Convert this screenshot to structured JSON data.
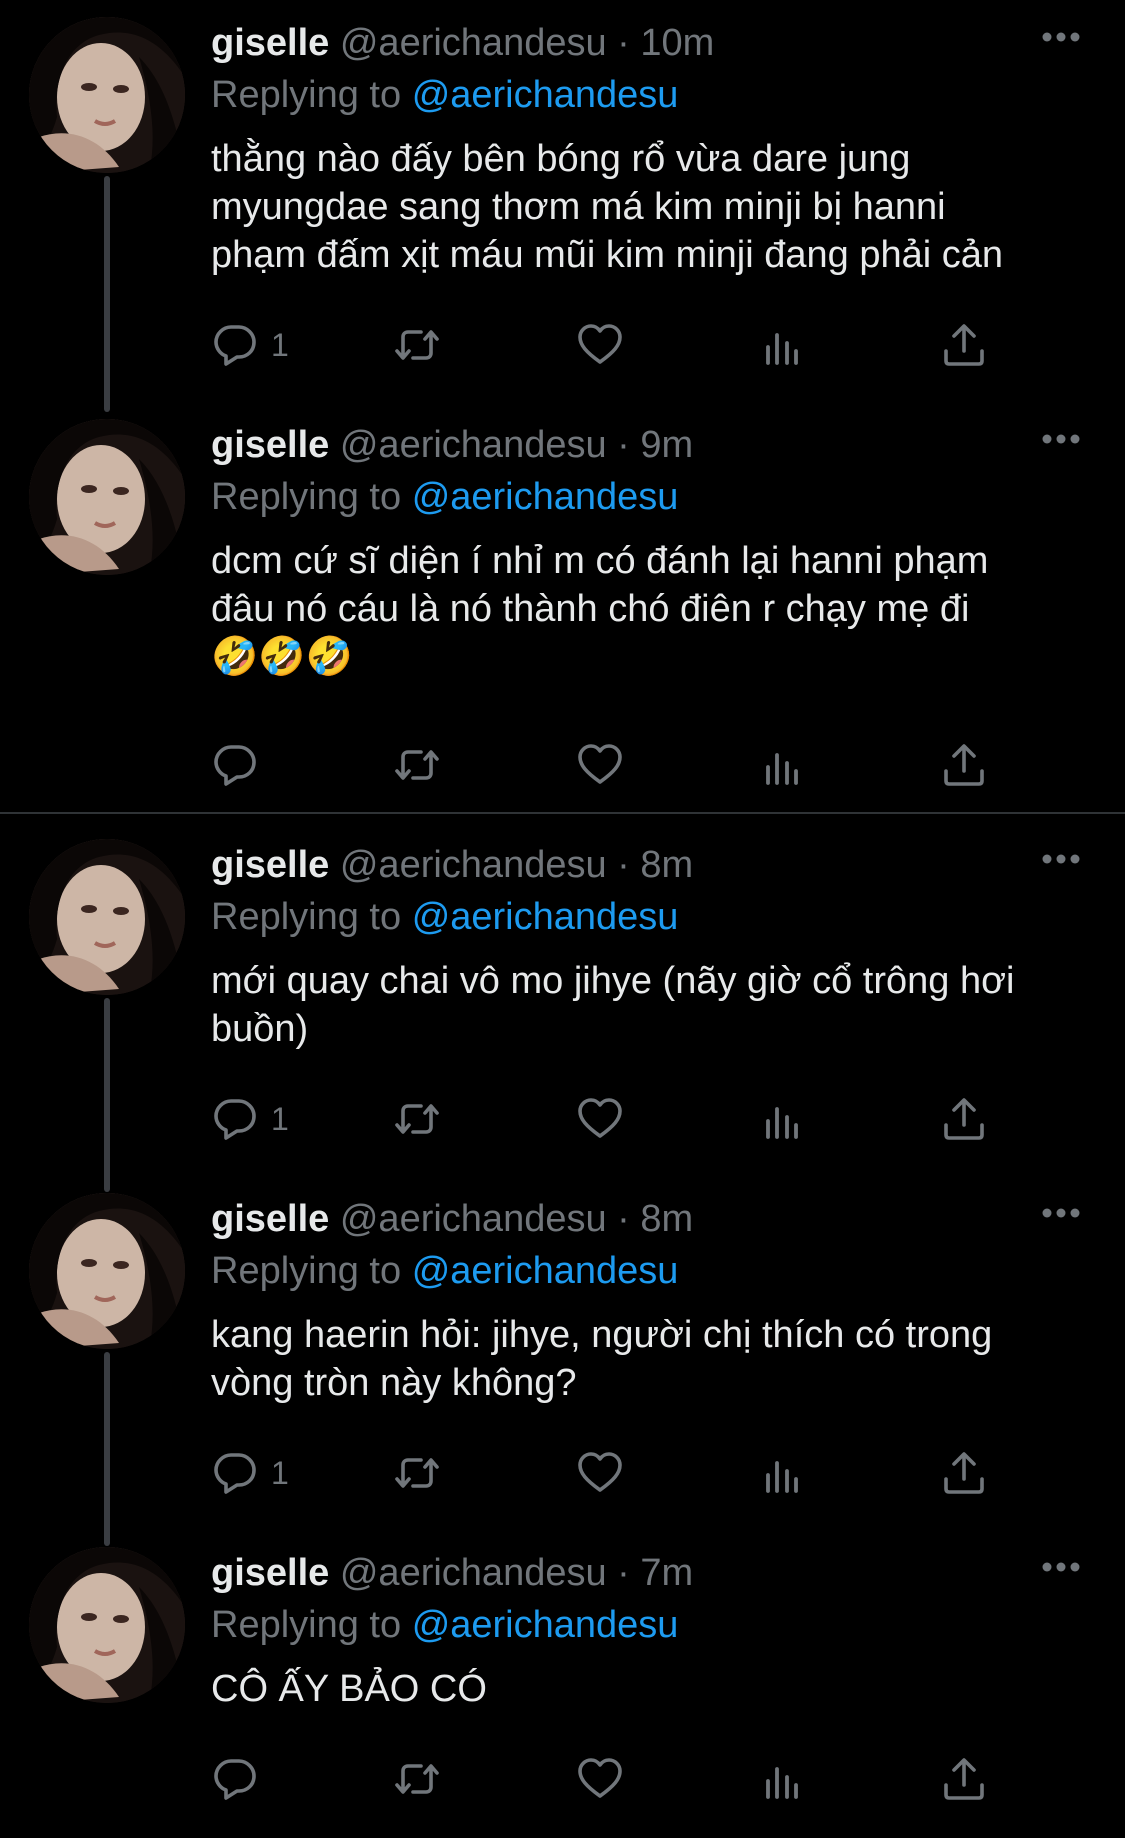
{
  "colors": {
    "background": "#000000",
    "text": "#e7e9ea",
    "muted": "#71767b",
    "accent": "#1d9bf0",
    "thread_line": "#3a3d42",
    "divider": "#2f3336"
  },
  "icons": {
    "more": "more-horizontal-icon",
    "reply": "reply-bubble-icon",
    "retweet": "retweet-icon",
    "like": "heart-icon",
    "views": "analytics-bars-icon",
    "share": "share-upload-icon"
  },
  "tweets": [
    {
      "name": "giselle",
      "handle": "@aerichandesu",
      "separator": "·",
      "time": "10m",
      "replying_label": "Replying to",
      "replying_to": "@aerichandesu",
      "text": "thằng nào đấy bên bóng rổ vừa dare jung\nmyungdae sang thơm má kim minji bị hanni\nphạm đấm xịt máu mũi kim minji đang phải cản",
      "reply_count": "1"
    },
    {
      "name": "giselle",
      "handle": "@aerichandesu",
      "separator": "·",
      "time": "9m",
      "replying_label": "Replying to",
      "replying_to": "@aerichandesu",
      "text": "dcm cứ sĩ diện í nhỉ m có đánh lại hanni phạm\nđâu nó cáu là nó thành chó điên r chạy mẹ đi\n🤣🤣🤣",
      "reply_count": ""
    },
    {
      "name": "giselle",
      "handle": "@aerichandesu",
      "separator": "·",
      "time": "8m",
      "replying_label": "Replying to",
      "replying_to": "@aerichandesu",
      "text": "mới quay chai vô mo jihye (nãy giờ cổ trông hơi\nbuồn)",
      "reply_count": "1"
    },
    {
      "name": "giselle",
      "handle": "@aerichandesu",
      "separator": "·",
      "time": "8m",
      "replying_label": "Replying to",
      "replying_to": "@aerichandesu",
      "text": "kang haerin hỏi: jihye, người chị thích có trong\nvòng tròn này không?",
      "reply_count": "1"
    },
    {
      "name": "giselle",
      "handle": "@aerichandesu",
      "separator": "·",
      "time": "7m",
      "replying_label": "Replying to",
      "replying_to": "@aerichandesu",
      "text": "CÔ ẤY BẢO CÓ",
      "reply_count": ""
    }
  ]
}
